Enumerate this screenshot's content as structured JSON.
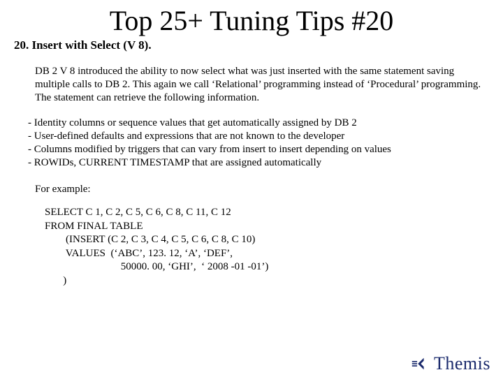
{
  "title": "Top 25+ Tuning Tips #20",
  "subtitle": "20. Insert with Select (V 8).",
  "paragraph": "DB 2 V 8 introduced the ability to now select what was just inserted with the same statement saving multiple calls to DB 2.  This again we call ‘Relational’ programming instead of ‘Procedural’ programming.  The statement can retrieve the following information.",
  "bullets": [
    "-  Identity columns or sequence values that get automatically assigned by DB 2",
    " - User-defined defaults and expressions that are not known to the developer",
    " - Columns modified by triggers that can vary from insert to insert depending on values",
    " - ROWIDs, CURRENT TIMESTAMP that are assigned automatically"
  ],
  "for_example": "For example:",
  "code_lines": [
    "SELECT C 1, C 2, C 5, C 6, C 8, C 11, C 12",
    "FROM FINAL TABLE",
    "        (INSERT (C 2, C 3, C 4, C 5, C 6, C 8, C 10)",
    "        VALUES  (‘ABC’, 123. 12, ‘A’, ‘DEF’,",
    "                             50000. 00, ‘GHI’,  ‘ 2008 -01 -01’)",
    "       )"
  ],
  "logo": {
    "text": "Themis"
  }
}
